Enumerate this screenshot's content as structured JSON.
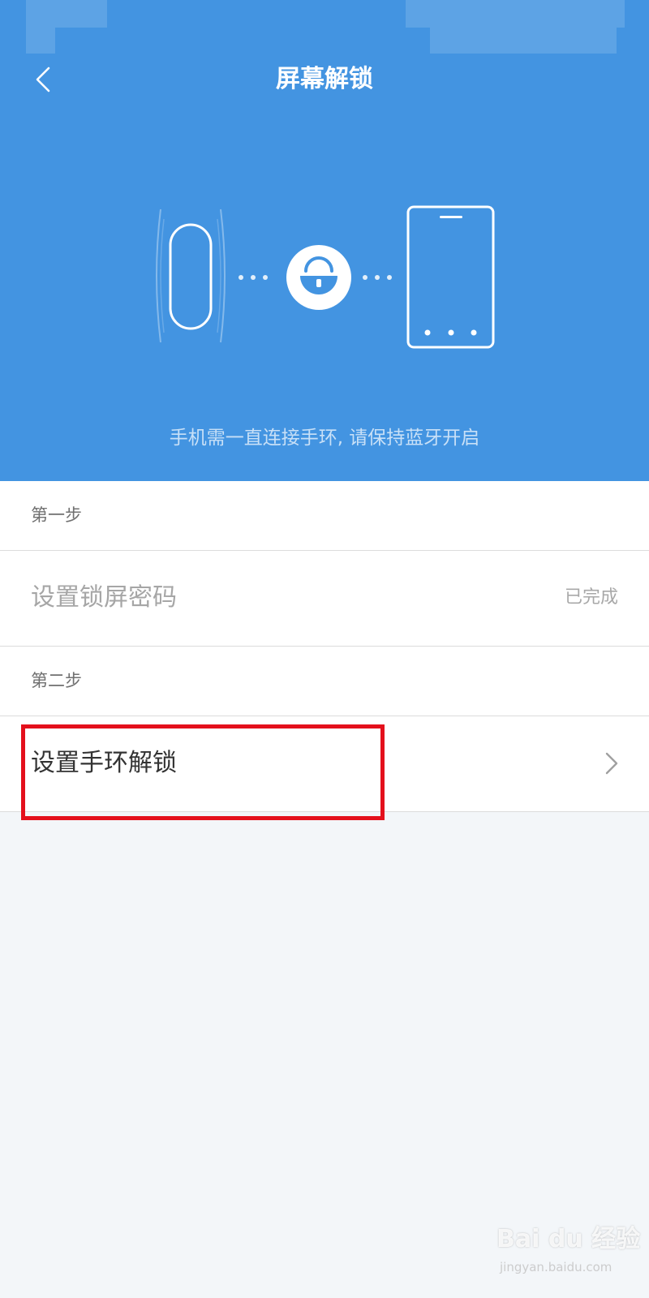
{
  "header": {
    "title": "屏幕解锁",
    "subtitle": "手机需一直连接手环, 请保持蓝牙开启",
    "background_color": "#4394e1"
  },
  "icons": {
    "back": "chevron-left-icon",
    "band": "wristband-icon",
    "lock": "unlocked-padlock-icon",
    "phone": "smartphone-icon",
    "chevron": "chevron-right-icon"
  },
  "steps": {
    "step1_label": "第一步",
    "step1_item": "设置锁屏密码",
    "step1_status": "已完成",
    "step2_label": "第二步",
    "step2_item": "设置手环解锁"
  },
  "highlight_color": "#e4101c",
  "watermark": {
    "main": "Bai du 经验",
    "sub": "jingyan.baidu.com"
  }
}
